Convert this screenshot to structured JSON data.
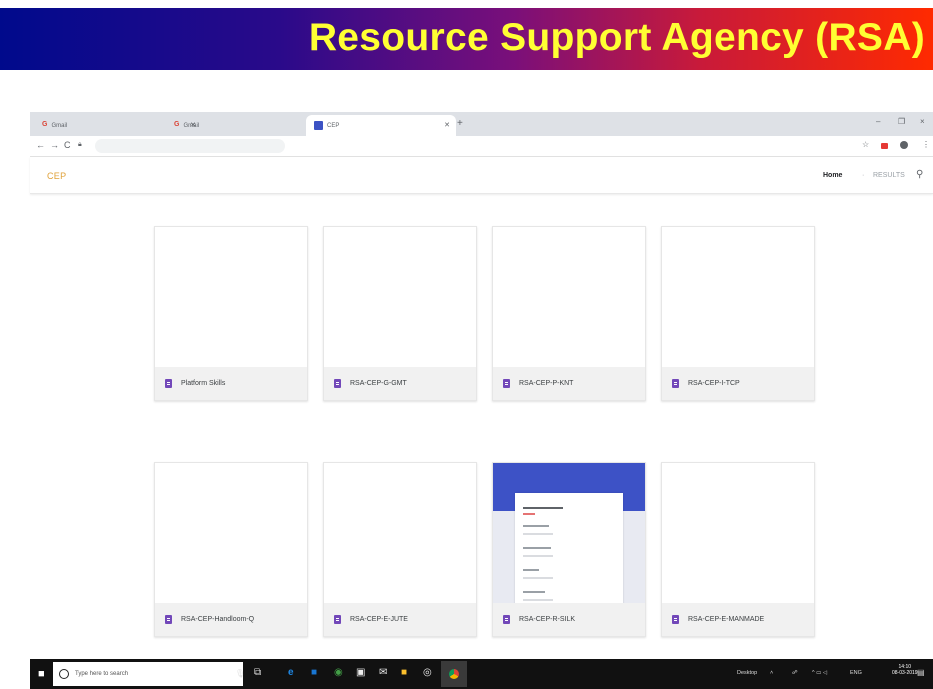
{
  "slide": {
    "title": "Resource Support Agency (RSA)"
  },
  "browser": {
    "tabs": [
      {
        "label": "Gmail",
        "favicon": "gmail-icon",
        "active": false
      },
      {
        "label": "Gmail",
        "favicon": "gmail-icon",
        "active": false
      },
      {
        "label": "CEP",
        "favicon": "forms-icon",
        "active": true
      }
    ],
    "newtab_symbol": "+",
    "window_controls": [
      "–",
      "❐",
      "×"
    ],
    "nav": {
      "back": "←",
      "forward": "→",
      "reload": "C"
    }
  },
  "app": {
    "brand": "CEP",
    "nav": {
      "home": "Home",
      "separator": "·",
      "results": "RESULTS"
    }
  },
  "cards": [
    {
      "label": "Platform Skills",
      "preview": false
    },
    {
      "label": "RSA-CEP-G-GMT",
      "preview": false
    },
    {
      "label": "RSA-CEP-P-KNT",
      "preview": false
    },
    {
      "label": "RSA-CEP-I-TCP",
      "preview": false
    },
    {
      "label": "RSA-CEP-Handloom-Q",
      "preview": false
    },
    {
      "label": "RSA-CEP-E-JUTE",
      "preview": false
    },
    {
      "label": "RSA-CEP-R-SILK",
      "preview": true
    },
    {
      "label": "RSA-CEP-E-MANMADE",
      "preview": false
    }
  ],
  "taskbar": {
    "search_placeholder": "Type here to search",
    "desktop_label": "Desktop",
    "lang": "ENG",
    "clock_time": "14:10",
    "clock_date": "08-03-2019"
  },
  "colors": {
    "brand": "#e0a23a",
    "form_icon": "#7248b9",
    "form_header": "#3d52c6",
    "banner_title": "#ffff33"
  }
}
